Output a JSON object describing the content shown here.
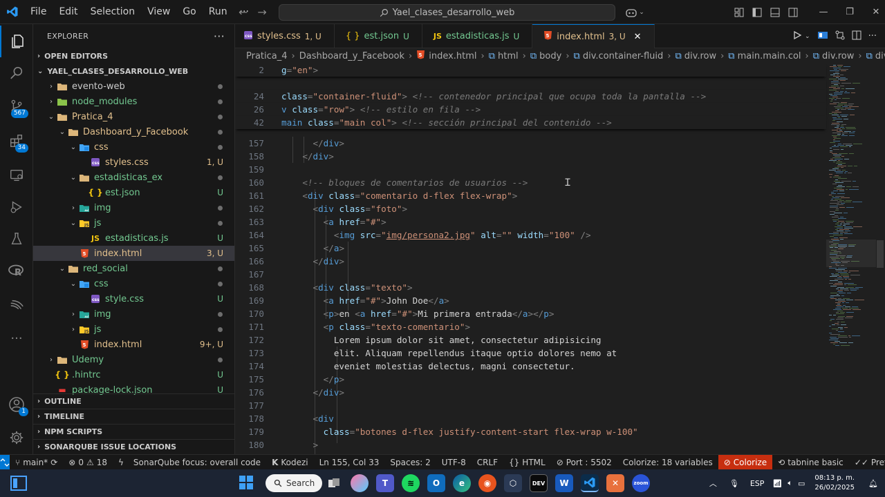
{
  "menu": [
    "File",
    "Edit",
    "Selection",
    "View",
    "Go",
    "Run",
    "···"
  ],
  "search": {
    "text": "Yael_clases_desarrollo_web"
  },
  "activity": {
    "scm_badge": "567",
    "ext_badge": "34",
    "account_badge": "1"
  },
  "sidebar": {
    "title": "EXPLORER",
    "open_editors": "OPEN EDITORS",
    "root": "YAEL_CLASES_DESARROLLO_WEB",
    "tree": [
      {
        "label": "evento-web",
        "indent": 1,
        "kind": "folder",
        "chev": "›",
        "status": "",
        "cls": "c-norm",
        "dot": true
      },
      {
        "label": "node_modules",
        "indent": 1,
        "kind": "folder-node",
        "chev": "›",
        "status": "",
        "cls": "c-git",
        "dot": true
      },
      {
        "label": "Pratica_4",
        "indent": 1,
        "kind": "folder",
        "chev": "⌄",
        "status": "",
        "cls": "c-warn",
        "dot": true
      },
      {
        "label": "Dashboard_y_Facebook",
        "indent": 2,
        "kind": "folder",
        "chev": "⌄",
        "status": "",
        "cls": "c-warn",
        "dot": true
      },
      {
        "label": "css",
        "indent": 3,
        "kind": "folder-css",
        "chev": "⌄",
        "status": "",
        "cls": "c-warn",
        "dot": true
      },
      {
        "label": "styles.css",
        "indent": 4,
        "kind": "css",
        "chev": "",
        "status": "1, U",
        "cls": "c-warn",
        "dot": false
      },
      {
        "label": "estadisticas_ex",
        "indent": 3,
        "kind": "folder",
        "chev": "⌄",
        "status": "",
        "cls": "c-git",
        "dot": true
      },
      {
        "label": "est.json",
        "indent": 4,
        "kind": "json",
        "chev": "",
        "status": "U",
        "cls": "c-git",
        "dot": false
      },
      {
        "label": "img",
        "indent": 3,
        "kind": "folder-img",
        "chev": "›",
        "status": "",
        "cls": "c-git",
        "dot": true
      },
      {
        "label": "js",
        "indent": 3,
        "kind": "folder-js",
        "chev": "⌄",
        "status": "",
        "cls": "c-git",
        "dot": true
      },
      {
        "label": "estadisticas.js",
        "indent": 4,
        "kind": "js",
        "chev": "",
        "status": "U",
        "cls": "c-git",
        "dot": false
      },
      {
        "label": "index.html",
        "indent": 3,
        "kind": "html",
        "chev": "",
        "status": "3, U",
        "cls": "c-warn",
        "dot": false,
        "selected": true
      },
      {
        "label": "red_social",
        "indent": 2,
        "kind": "folder",
        "chev": "⌄",
        "status": "",
        "cls": "c-git",
        "dot": true
      },
      {
        "label": "css",
        "indent": 3,
        "kind": "folder-css",
        "chev": "⌄",
        "status": "",
        "cls": "c-git",
        "dot": true
      },
      {
        "label": "style.css",
        "indent": 4,
        "kind": "css",
        "chev": "",
        "status": "U",
        "cls": "c-git",
        "dot": false
      },
      {
        "label": "img",
        "indent": 3,
        "kind": "folder-img",
        "chev": "›",
        "status": "",
        "cls": "c-git",
        "dot": true
      },
      {
        "label": "js",
        "indent": 3,
        "kind": "folder-js",
        "chev": "›",
        "status": "",
        "cls": "c-git",
        "dot": true
      },
      {
        "label": "index.html",
        "indent": 3,
        "kind": "html",
        "chev": "",
        "status": "9+, U",
        "cls": "c-warn",
        "dot": false
      },
      {
        "label": "Udemy",
        "indent": 1,
        "kind": "folder",
        "chev": "›",
        "status": "",
        "cls": "c-git",
        "dot": true
      },
      {
        "label": ".hintrc",
        "indent": 1,
        "kind": "json",
        "chev": "",
        "status": "U",
        "cls": "c-git",
        "dot": false
      },
      {
        "label": "package-lock.json",
        "indent": 1,
        "kind": "json-red",
        "chev": "",
        "status": "U",
        "cls": "c-git",
        "dot": false
      }
    ],
    "bottom_sections": [
      "OUTLINE",
      "TIMELINE",
      "NPM SCRIPTS",
      "SONARQUBE ISSUE LOCATIONS"
    ]
  },
  "tabs": [
    {
      "icon": "css",
      "label": "styles.css",
      "status": "1, U",
      "ucls": ""
    },
    {
      "icon": "json",
      "label": "est.json",
      "status": "U",
      "ucls": "u"
    },
    {
      "icon": "js",
      "label": "estadisticas.js",
      "status": "U",
      "ucls": "u"
    },
    {
      "icon": "html",
      "label": "index.html",
      "status": "3, U",
      "ucls": "",
      "active": true
    }
  ],
  "breadcrumb": [
    "Pratica_4",
    "Dashboard_y_Facebook",
    "index.html",
    "html",
    "body",
    "div.container-fluid",
    "div.row",
    "main.main.col",
    "div.row",
    "div.column"
  ],
  "editor": {
    "sticky": [
      {
        "ln": "2",
        "html": "<span class='t-attr'>g</span><span class='t-punc'>=</span><span class='t-str'>\"en\"</span><span class='t-punc'>&gt;</span>"
      },
      {
        "ln": "24",
        "html": "<span class='t-attr'>class</span><span class='t-punc'>=</span><span class='t-str'>\"container-fluid\"</span><span class='t-punc'>&gt;</span> <span class='t-cmt2'>&lt;!-- contenedor principal que ocupa toda la pantalla --&gt;</span>"
      },
      {
        "ln": "26",
        "html": "<span class='t-tag'>v</span> <span class='t-attr'>class</span><span class='t-punc'>=</span><span class='t-str'>\"row\"</span><span class='t-punc'>&gt;</span> <span class='t-cmt2'>&lt;!-- estilo en fila --&gt;</span>"
      },
      {
        "ln": "42",
        "html": "<span class='t-tag'>main</span> <span class='t-attr'>class</span><span class='t-punc'>=</span><span class='t-str'>\"main col\"</span><span class='t-punc'>&gt;</span> <span class='t-cmt2'>&lt;!-- sección principal del contenido --&gt;</span>"
      }
    ],
    "lines": [
      {
        "ln": "157",
        "html": "      <span class='t-punc'>&lt;/</span><span class='t-tag'>div</span><span class='t-punc'>&gt;</span>"
      },
      {
        "ln": "158",
        "html": "    <span class='t-punc'>&lt;/</span><span class='t-tag'>div</span><span class='t-punc'>&gt;</span>"
      },
      {
        "ln": "159",
        "html": ""
      },
      {
        "ln": "160",
        "html": "    <span class='t-cmt2'>&lt;!-- bloques de comentarios de usuarios --&gt;</span>"
      },
      {
        "ln": "161",
        "html": "    <span class='t-punc'>&lt;</span><span class='t-tag'>div</span> <span class='t-attr'>class</span><span class='t-punc'>=</span><span class='t-str'>\"comentario d-flex flex-wrap\"</span><span class='t-punc'>&gt;</span>"
      },
      {
        "ln": "162",
        "html": "      <span class='t-punc'>&lt;</span><span class='t-tag'>div</span> <span class='t-attr'>class</span><span class='t-punc'>=</span><span class='t-str'>\"foto\"</span><span class='t-punc'>&gt;</span>"
      },
      {
        "ln": "163",
        "html": "        <span class='t-punc'>&lt;</span><span class='t-tag'>a</span> <span class='t-attr'>href</span><span class='t-punc'>=</span><span class='t-str'>\"#\"</span><span class='t-punc'>&gt;</span>"
      },
      {
        "ln": "164",
        "html": "          <span class='t-punc'>&lt;</span><span class='t-tag'>img</span> <span class='t-attr'>src</span><span class='t-punc'>=</span><span class='t-str'>\"<u>img/persona2.jpg</u>\"</span> <span class='t-attr'>alt</span><span class='t-punc'>=</span><span class='t-str'>\"\"</span> <span class='t-attr'>width</span><span class='t-punc'>=</span><span class='t-str'>\"100\"</span> <span class='t-punc'>/&gt;</span>"
      },
      {
        "ln": "165",
        "html": "        <span class='t-punc'>&lt;/</span><span class='t-tag'>a</span><span class='t-punc'>&gt;</span>"
      },
      {
        "ln": "166",
        "html": "      <span class='t-punc'>&lt;/</span><span class='t-tag'>div</span><span class='t-punc'>&gt;</span>"
      },
      {
        "ln": "167",
        "html": ""
      },
      {
        "ln": "168",
        "html": "      <span class='t-punc'>&lt;</span><span class='t-tag'>div</span> <span class='t-attr'>class</span><span class='t-punc'>=</span><span class='t-str'>\"texto\"</span><span class='t-punc'>&gt;</span>"
      },
      {
        "ln": "169",
        "html": "        <span class='t-punc'>&lt;</span><span class='t-tag'>a</span> <span class='t-attr'>href</span><span class='t-punc'>=</span><span class='t-str'>\"#\"</span><span class='t-punc'>&gt;</span><span class='t-txt'>John Doe</span><span class='t-punc'>&lt;/</span><span class='t-tag'>a</span><span class='t-punc'>&gt;</span>"
      },
      {
        "ln": "170",
        "html": "        <span class='t-punc'>&lt;</span><span class='t-tag'>p</span><span class='t-punc'>&gt;</span><span class='t-txt'>en </span><span class='t-punc'>&lt;</span><span class='t-tag'>a</span> <span class='t-attr'>href</span><span class='t-punc'>=</span><span class='t-str'>\"#\"</span><span class='t-punc'>&gt;</span><span class='t-txt'>Mi primera entrada</span><span class='t-punc'>&lt;/</span><span class='t-tag'>a</span><span class='t-punc'>&gt;&lt;/</span><span class='t-tag'>p</span><span class='t-punc'>&gt;</span>"
      },
      {
        "ln": "171",
        "html": "        <span class='t-punc'>&lt;</span><span class='t-tag'>p</span> <span class='t-attr'>class</span><span class='t-punc'>=</span><span class='t-str'>\"texto-comentario\"</span><span class='t-punc'>&gt;</span>"
      },
      {
        "ln": "172",
        "html": "          <span class='t-txt'>Lorem ipsum dolor sit amet, consectetur adipisicing</span>"
      },
      {
        "ln": "173",
        "html": "          <span class='t-txt'>elit. Aliquam repellendus itaque optio dolores nemo at</span>"
      },
      {
        "ln": "174",
        "html": "          <span class='t-txt'>eveniet molestias delectus, magni consectetur.</span>"
      },
      {
        "ln": "175",
        "html": "        <span class='t-punc'>&lt;/</span><span class='t-tag'>p</span><span class='t-punc'>&gt;</span>"
      },
      {
        "ln": "176",
        "html": "      <span class='t-punc'>&lt;/</span><span class='t-tag'>div</span><span class='t-punc'>&gt;</span>"
      },
      {
        "ln": "177",
        "html": ""
      },
      {
        "ln": "178",
        "html": "      <span class='t-punc'>&lt;</span><span class='t-tag'>div</span>"
      },
      {
        "ln": "179",
        "html": "        <span class='t-attr'>class</span><span class='t-punc'>=</span><span class='t-str'>\"botones d-flex justify-content-start flex-wrap w-100\"</span>"
      },
      {
        "ln": "180",
        "html": "      <span class='t-punc'>&gt;</span>"
      }
    ]
  },
  "status": {
    "branch": "main*",
    "errors": "0",
    "warnings": "18",
    "sonar": "SonarQube focus: overall code",
    "kodezi": "Kodezi",
    "position": "Ln 155, Col 33",
    "spaces": "Spaces: 2",
    "encoding": "UTF-8",
    "eol": "CRLF",
    "language": "HTML",
    "port": "Port : 5502",
    "colorize_vars": "Colorize: 18 variables",
    "colorize": "Colorize",
    "tabnine": "tabnine basic",
    "prettier": "Prettier"
  },
  "taskbar": {
    "search": "Search",
    "lang": "ESP",
    "time": "08:13 p. m.",
    "date": "26/02/2025"
  }
}
